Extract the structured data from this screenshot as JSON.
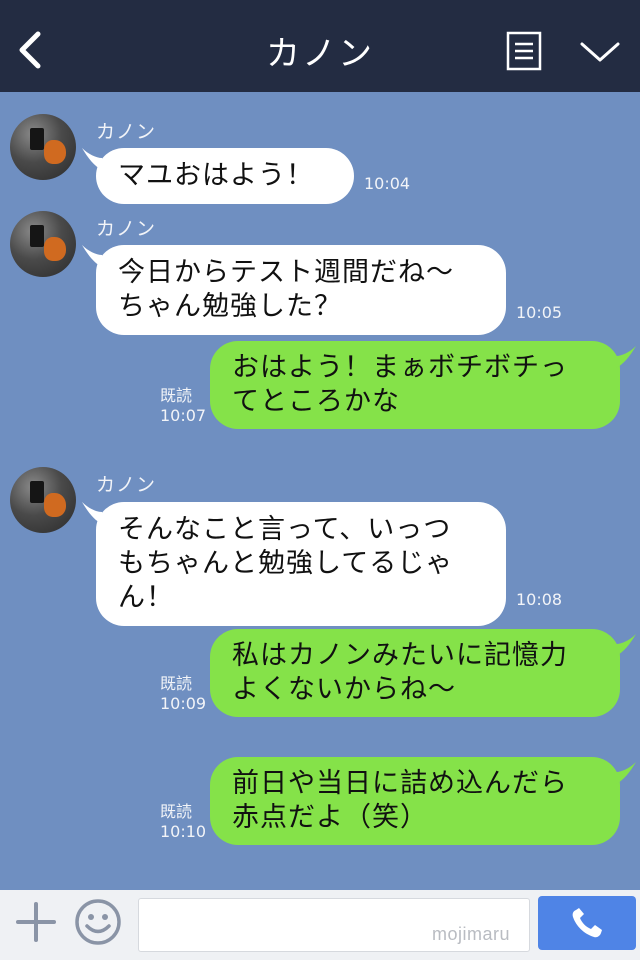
{
  "header": {
    "title": "カノン",
    "back_icon": "chevron-left-icon",
    "memo_icon": "notes-icon",
    "menu_icon": "chevron-down-icon",
    "background": "#232c42"
  },
  "chat": {
    "background": "#6f8fc1",
    "incoming_color": "#ffffff",
    "outgoing_color": "#85e249",
    "messages": [
      {
        "dir": "in",
        "sender": "カノン",
        "text": "マユおはよう！",
        "time": "10:04"
      },
      {
        "dir": "in",
        "sender": "カノン",
        "text": "今日からテスト週間だね〜\nちゃん勉強した？",
        "time": "10:05"
      },
      {
        "dir": "out",
        "read": "既読",
        "text": "おはよう！まぁボチボチっ\nてところかな",
        "time": "10:07"
      },
      {
        "dir": "in",
        "sender": "カノン",
        "text": "そんなこと言って、いっつ\nもちゃんと勉強してるじゃ\nん！",
        "time": "10:08"
      },
      {
        "dir": "out",
        "read": "既読",
        "text": "私はカノンみたいに記憶力\nよくないからね〜",
        "time": "10:09"
      },
      {
        "dir": "out",
        "read": "既読",
        "text": "前日や当日に詰め込んだら\n赤点だよ（笑）",
        "time": "10:10"
      }
    ]
  },
  "input_bar": {
    "plus_icon": "plus-icon",
    "sticker_icon": "smiley-icon",
    "message_value": "",
    "call_icon": "phone-icon",
    "call_color": "#4f84e6"
  },
  "watermark": "mojimaru"
}
